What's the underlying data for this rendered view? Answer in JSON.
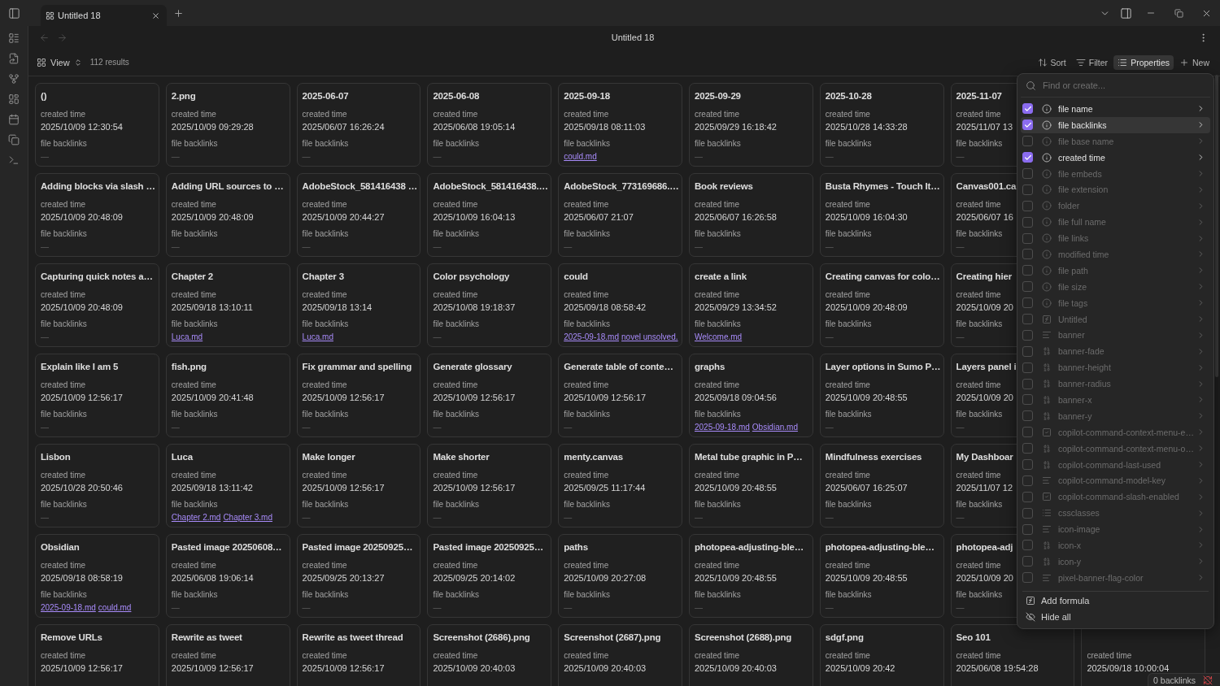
{
  "tabs": [
    {
      "title": "Untitled 18",
      "selected": true
    }
  ],
  "navigation": {
    "back": {
      "disabled": true
    },
    "forward": {
      "disabled": true
    }
  },
  "header": {
    "title": "Untitled 18"
  },
  "toolbar": {
    "view": "View",
    "results": "112 results",
    "actions": [
      {
        "kind": "sort",
        "label": "Sort",
        "selected": false
      },
      {
        "kind": "filter",
        "label": "Filter",
        "selected": false
      },
      {
        "kind": "properties",
        "label": "Properties",
        "selected": true
      },
      {
        "kind": "new",
        "label": "New",
        "selected": false
      }
    ]
  },
  "rows": [
    {
      "cards": [
        {
          "title": "()",
          "fields": [
            {
              "kind": "date",
              "label": "created time",
              "value": "2025/10/09 12:30:54"
            },
            {
              "kind": "empty",
              "label": "file backlinks",
              "value": "—"
            }
          ]
        },
        {
          "title": "2.png",
          "fields": [
            {
              "kind": "date",
              "label": "created time",
              "value": "2025/10/09 09:29:28"
            },
            {
              "kind": "empty",
              "label": "file backlinks",
              "value": "—"
            }
          ]
        },
        {
          "title": "2025-06-07",
          "fields": [
            {
              "kind": "date",
              "label": "created time",
              "value": "2025/06/07 16:26:24"
            },
            {
              "kind": "empty",
              "label": "file backlinks",
              "value": "—"
            }
          ]
        },
        {
          "title": "2025-06-08",
          "fields": [
            {
              "kind": "date",
              "label": "created time",
              "value": "2025/06/08 19:05:14"
            },
            {
              "kind": "empty",
              "label": "file backlinks",
              "value": "—"
            }
          ]
        },
        {
          "title": "2025-09-18",
          "fields": [
            {
              "kind": "date",
              "label": "created time",
              "value": "2025/09/18 08:11:03"
            },
            {
              "kind": "links",
              "label": "file backlinks",
              "links": [
                "could.md"
              ]
            }
          ]
        },
        {
          "title": "2025-09-29",
          "fields": [
            {
              "kind": "date",
              "label": "created time",
              "value": "2025/09/29 16:18:42"
            },
            {
              "kind": "empty",
              "label": "file backlinks",
              "value": "—"
            }
          ]
        },
        {
          "title": "2025-10-28",
          "fields": [
            {
              "kind": "date",
              "label": "created time",
              "value": "2025/10/28 14:33:28"
            },
            {
              "kind": "empty",
              "label": "file backlinks",
              "value": "—"
            }
          ]
        },
        {
          "title": "2025-11-07",
          "fields": [
            {
              "kind": "date",
              "label": "created time",
              "value": "2025/11/07 13"
            },
            {
              "kind": "empty",
              "label": "file backlinks",
              "value": "—"
            }
          ]
        }
      ]
    },
    {
      "cards": [
        {
          "title": "Adding blocks via slash …",
          "fields": [
            {
              "kind": "date",
              "label": "created time",
              "value": "2025/10/09 20:48:09"
            },
            {
              "kind": "empty",
              "label": "file backlinks",
              "value": "—"
            }
          ]
        },
        {
          "title": "Adding URL sources to …",
          "fields": [
            {
              "kind": "date",
              "label": "created time",
              "value": "2025/10/09 20:48:09"
            },
            {
              "kind": "empty",
              "label": "file backlinks",
              "value": "—"
            }
          ]
        },
        {
          "title": "AdobeStock_581416438 …",
          "fields": [
            {
              "kind": "date",
              "label": "created time",
              "value": "2025/10/09 20:44:27"
            },
            {
              "kind": "empty",
              "label": "file backlinks",
              "value": "—"
            }
          ]
        },
        {
          "title": "AdobeStock_581416438.…",
          "fields": [
            {
              "kind": "date",
              "label": "created time",
              "value": "2025/10/09 16:04:13"
            },
            {
              "kind": "empty",
              "label": "file backlinks",
              "value": "—"
            }
          ]
        },
        {
          "title": "AdobeStock_773169686.…",
          "fields": [
            {
              "kind": "date",
              "label": "created time",
              "value": "2025/06/07 21:07"
            },
            {
              "kind": "empty",
              "label": "file backlinks",
              "value": "—"
            }
          ]
        },
        {
          "title": "Book reviews",
          "fields": [
            {
              "kind": "date",
              "label": "created time",
              "value": "2025/06/07 16:26:58"
            },
            {
              "kind": "empty",
              "label": "file backlinks",
              "value": "—"
            }
          ]
        },
        {
          "title": "Busta Rhymes - Touch It…",
          "fields": [
            {
              "kind": "date",
              "label": "created time",
              "value": "2025/10/09 16:04:30"
            },
            {
              "kind": "empty",
              "label": "file backlinks",
              "value": "—"
            }
          ]
        },
        {
          "title": "Canvas001.ca",
          "fields": [
            {
              "kind": "date",
              "label": "created time",
              "value": "2025/06/07 16"
            },
            {
              "kind": "empty",
              "label": "file backlinks",
              "value": "—"
            }
          ]
        }
      ]
    },
    {
      "cards": [
        {
          "title": "Capturing quick notes a…",
          "fields": [
            {
              "kind": "date",
              "label": "created time",
              "value": "2025/10/09 20:48:09"
            },
            {
              "kind": "empty",
              "label": "file backlinks",
              "value": "—"
            }
          ]
        },
        {
          "title": "Chapter 2",
          "fields": [
            {
              "kind": "date",
              "label": "created time",
              "value": "2025/09/18 13:10:11"
            },
            {
              "kind": "links",
              "label": "file backlinks",
              "links": [
                "Luca.md"
              ]
            }
          ]
        },
        {
          "title": "Chapter 3",
          "fields": [
            {
              "kind": "date",
              "label": "created time",
              "value": "2025/09/18 13:14"
            },
            {
              "kind": "links",
              "label": "file backlinks",
              "links": [
                "Luca.md"
              ]
            }
          ]
        },
        {
          "title": "Color psychology",
          "fields": [
            {
              "kind": "date",
              "label": "created time",
              "value": "2025/10/08 19:18:37"
            },
            {
              "kind": "empty",
              "label": "file backlinks",
              "value": "—"
            }
          ]
        },
        {
          "title": "could",
          "fields": [
            {
              "kind": "date",
              "label": "created time",
              "value": "2025/09/18 08:58:42"
            },
            {
              "kind": "links",
              "label": "file backlinks",
              "links": [
                "2025-09-18.md",
                "novel unsolved."
              ]
            }
          ]
        },
        {
          "title": "create a link",
          "fields": [
            {
              "kind": "date",
              "label": "created time",
              "value": "2025/09/29 13:34:52"
            },
            {
              "kind": "links",
              "label": "file backlinks",
              "links": [
                "Welcome.md"
              ]
            }
          ]
        },
        {
          "title": "Creating canvas for colo…",
          "fields": [
            {
              "kind": "date",
              "label": "created time",
              "value": "2025/10/09 20:48:09"
            },
            {
              "kind": "empty",
              "label": "file backlinks",
              "value": "—"
            }
          ]
        },
        {
          "title": "Creating hier",
          "fields": [
            {
              "kind": "date",
              "label": "created time",
              "value": "2025/10/09 20"
            },
            {
              "kind": "empty",
              "label": "file backlinks",
              "value": "—"
            }
          ]
        }
      ]
    },
    {
      "cards": [
        {
          "title": "Explain like I am 5",
          "fields": [
            {
              "kind": "date",
              "label": "created time",
              "value": "2025/10/09 12:56:17"
            },
            {
              "kind": "empty",
              "label": "file backlinks",
              "value": "—"
            }
          ]
        },
        {
          "title": "fish.png",
          "fields": [
            {
              "kind": "date",
              "label": "created time",
              "value": "2025/10/09 20:41:48"
            },
            {
              "kind": "empty",
              "label": "file backlinks",
              "value": "—"
            }
          ]
        },
        {
          "title": "Fix grammar and spelling",
          "fields": [
            {
              "kind": "date",
              "label": "created time",
              "value": "2025/10/09 12:56:17"
            },
            {
              "kind": "empty",
              "label": "file backlinks",
              "value": "—"
            }
          ]
        },
        {
          "title": "Generate glossary",
          "fields": [
            {
              "kind": "date",
              "label": "created time",
              "value": "2025/10/09 12:56:17"
            },
            {
              "kind": "empty",
              "label": "file backlinks",
              "value": "—"
            }
          ]
        },
        {
          "title": "Generate table of conte…",
          "fields": [
            {
              "kind": "date",
              "label": "created time",
              "value": "2025/10/09 12:56:17"
            },
            {
              "kind": "empty",
              "label": "file backlinks",
              "value": "—"
            }
          ]
        },
        {
          "title": "graphs",
          "fields": [
            {
              "kind": "date",
              "label": "created time",
              "value": "2025/09/18 09:04:56"
            },
            {
              "kind": "links",
              "label": "file backlinks",
              "links": [
                "2025-09-18.md",
                "Obsidian.md"
              ]
            }
          ]
        },
        {
          "title": "Layer options in Sumo P…",
          "fields": [
            {
              "kind": "date",
              "label": "created time",
              "value": "2025/10/09 20:48:55"
            },
            {
              "kind": "empty",
              "label": "file backlinks",
              "value": "—"
            }
          ]
        },
        {
          "title": "Layers panel i",
          "fields": [
            {
              "kind": "date",
              "label": "created time",
              "value": "2025/10/09 20"
            },
            {
              "kind": "empty",
              "label": "file backlinks",
              "value": "—"
            }
          ]
        }
      ]
    },
    {
      "cards": [
        {
          "title": "Lisbon",
          "fields": [
            {
              "kind": "date",
              "label": "created time",
              "value": "2025/10/28 20:50:46"
            },
            {
              "kind": "empty",
              "label": "file backlinks",
              "value": "—"
            }
          ]
        },
        {
          "title": "Luca",
          "fields": [
            {
              "kind": "date",
              "label": "created time",
              "value": "2025/09/18 13:11:42"
            },
            {
              "kind": "links",
              "label": "file backlinks",
              "links": [
                "Chapter 2.md",
                "Chapter 3.md"
              ]
            }
          ]
        },
        {
          "title": "Make longer",
          "fields": [
            {
              "kind": "date",
              "label": "created time",
              "value": "2025/10/09 12:56:17"
            },
            {
              "kind": "empty",
              "label": "file backlinks",
              "value": "—"
            }
          ]
        },
        {
          "title": "Make shorter",
          "fields": [
            {
              "kind": "date",
              "label": "created time",
              "value": "2025/10/09 12:56:17"
            },
            {
              "kind": "empty",
              "label": "file backlinks",
              "value": "—"
            }
          ]
        },
        {
          "title": "menty.canvas",
          "fields": [
            {
              "kind": "date",
              "label": "created time",
              "value": "2025/09/25 11:17:44"
            },
            {
              "kind": "empty",
              "label": "file backlinks",
              "value": "—"
            }
          ]
        },
        {
          "title": "Metal tube graphic in P…",
          "fields": [
            {
              "kind": "date",
              "label": "created time",
              "value": "2025/10/09 20:48:55"
            },
            {
              "kind": "empty",
              "label": "file backlinks",
              "value": "—"
            }
          ]
        },
        {
          "title": "Mindfulness exercises",
          "fields": [
            {
              "kind": "date",
              "label": "created time",
              "value": "2025/06/07 16:25:07"
            },
            {
              "kind": "empty",
              "label": "file backlinks",
              "value": "—"
            }
          ]
        },
        {
          "title": "My Dashboar",
          "fields": [
            {
              "kind": "date",
              "label": "created time",
              "value": "2025/11/07 12"
            },
            {
              "kind": "empty",
              "label": "file backlinks",
              "value": "—"
            }
          ]
        }
      ]
    },
    {
      "cards": [
        {
          "title": "Obsidian",
          "fields": [
            {
              "kind": "date",
              "label": "created time",
              "value": "2025/09/18 08:58:19"
            },
            {
              "kind": "links",
              "label": "file backlinks",
              "links": [
                "2025-09-18.md",
                "could.md"
              ]
            }
          ]
        },
        {
          "title": "Pasted image 20250608…",
          "fields": [
            {
              "kind": "date",
              "label": "created time",
              "value": "2025/06/08 19:06:14"
            },
            {
              "kind": "empty",
              "label": "file backlinks",
              "value": "—"
            }
          ]
        },
        {
          "title": "Pasted image 20250925…",
          "fields": [
            {
              "kind": "date",
              "label": "created time",
              "value": "2025/09/25 20:13:27"
            },
            {
              "kind": "empty",
              "label": "file backlinks",
              "value": "—"
            }
          ]
        },
        {
          "title": "Pasted image 20250925…",
          "fields": [
            {
              "kind": "date",
              "label": "created time",
              "value": "2025/09/25 20:14:02"
            },
            {
              "kind": "empty",
              "label": "file backlinks",
              "value": "—"
            }
          ]
        },
        {
          "title": "paths",
          "fields": [
            {
              "kind": "date",
              "label": "created time",
              "value": "2025/10/09 20:27:08"
            },
            {
              "kind": "empty",
              "label": "file backlinks",
              "value": "—"
            }
          ]
        },
        {
          "title": "photopea-adjusting-ble…",
          "fields": [
            {
              "kind": "date",
              "label": "created time",
              "value": "2025/10/09 20:48:55"
            },
            {
              "kind": "empty",
              "label": "file backlinks",
              "value": "—"
            }
          ]
        },
        {
          "title": "photopea-adjusting-ble…",
          "fields": [
            {
              "kind": "date",
              "label": "created time",
              "value": "2025/10/09 20:48:55"
            },
            {
              "kind": "empty",
              "label": "file backlinks",
              "value": "—"
            }
          ]
        },
        {
          "title": "photopea-adj",
          "fields": [
            {
              "kind": "date",
              "label": "created time",
              "value": "2025/10/09 20"
            },
            {
              "kind": "empty",
              "label": "file backlinks",
              "value": "—"
            }
          ]
        }
      ]
    },
    {
      "cards": [
        {
          "title": "Remove URLs",
          "fields": [
            {
              "kind": "date",
              "label": "created time",
              "value": "2025/10/09 12:56:17"
            }
          ]
        },
        {
          "title": "Rewrite as tweet",
          "fields": [
            {
              "kind": "date",
              "label": "created time",
              "value": "2025/10/09 12:56:17"
            }
          ]
        },
        {
          "title": "Rewrite as tweet thread",
          "fields": [
            {
              "kind": "date",
              "label": "created time",
              "value": "2025/10/09 12:56:17"
            }
          ]
        },
        {
          "title": "Screenshot (2686).png",
          "fields": [
            {
              "kind": "date",
              "label": "created time",
              "value": "2025/10/09 20:40:03"
            }
          ]
        },
        {
          "title": "Screenshot (2687).png",
          "fields": [
            {
              "kind": "date",
              "label": "created time",
              "value": "2025/10/09 20:40:03"
            }
          ]
        },
        {
          "title": "Screenshot (2688).png",
          "fields": [
            {
              "kind": "date",
              "label": "created time",
              "value": "2025/10/09 20:40:03"
            }
          ]
        },
        {
          "title": "sdgf.png",
          "fields": [
            {
              "kind": "date",
              "label": "created time",
              "value": "2025/10/09 20:42"
            }
          ]
        },
        {
          "title": "Seo 101",
          "fields": [
            {
              "kind": "date",
              "label": "created time",
              "value": "2025/06/08 19:54:28"
            }
          ]
        },
        {
          "fields": [
            {
              "kind": "date",
              "label": "created time",
              "value": "2025/09/18 10:00:04"
            }
          ]
        }
      ]
    }
  ],
  "properties_menu": {
    "placeholder": "Find or create...",
    "items": [
      {
        "kind": "info",
        "label": "file name",
        "checked": true,
        "selected": false
      },
      {
        "kind": "info",
        "label": "file backlinks",
        "checked": true,
        "selected": true
      },
      {
        "kind": "info",
        "label": "file base name",
        "checked": false,
        "selected": false
      },
      {
        "kind": "info",
        "label": "created time",
        "checked": true,
        "selected": false
      },
      {
        "kind": "info",
        "label": "file embeds",
        "checked": false,
        "selected": false
      },
      {
        "kind": "info",
        "label": "file extension",
        "checked": false,
        "selected": false
      },
      {
        "kind": "info",
        "label": "folder",
        "checked": false,
        "selected": false
      },
      {
        "kind": "info",
        "label": "file full name",
        "checked": false,
        "selected": false
      },
      {
        "kind": "info",
        "label": "file links",
        "checked": false,
        "selected": false
      },
      {
        "kind": "info",
        "label": "modified time",
        "checked": false,
        "selected": false
      },
      {
        "kind": "info",
        "label": "file path",
        "checked": false,
        "selected": false
      },
      {
        "kind": "info",
        "label": "file size",
        "checked": false,
        "selected": false
      },
      {
        "kind": "info",
        "label": "file tags",
        "checked": false,
        "selected": false
      },
      {
        "kind": "formula",
        "label": "Untitled",
        "checked": false,
        "selected": false
      },
      {
        "kind": "text",
        "label": "banner",
        "checked": false,
        "selected": false
      },
      {
        "kind": "number",
        "label": "banner-fade",
        "checked": false,
        "selected": false
      },
      {
        "kind": "number",
        "label": "banner-height",
        "checked": false,
        "selected": false
      },
      {
        "kind": "number",
        "label": "banner-radius",
        "checked": false,
        "selected": false
      },
      {
        "kind": "number",
        "label": "banner-x",
        "checked": false,
        "selected": false
      },
      {
        "kind": "number",
        "label": "banner-y",
        "checked": false,
        "selected": false
      },
      {
        "kind": "checkbox",
        "label": "copilot-command-context-menu-e…",
        "checked": false,
        "selected": false
      },
      {
        "kind": "number",
        "label": "copilot-command-context-menu-o…",
        "checked": false,
        "selected": false
      },
      {
        "kind": "number",
        "label": "copilot-command-last-used",
        "checked": false,
        "selected": false
      },
      {
        "kind": "text",
        "label": "copilot-command-model-key",
        "checked": false,
        "selected": false
      },
      {
        "kind": "checkbox",
        "label": "copilot-command-slash-enabled",
        "checked": false,
        "selected": false
      },
      {
        "kind": "list",
        "label": "cssclasses",
        "checked": false,
        "selected": false
      },
      {
        "kind": "text",
        "label": "icon-image",
        "checked": false,
        "selected": false
      },
      {
        "kind": "number",
        "label": "icon-x",
        "checked": false,
        "selected": false
      },
      {
        "kind": "number",
        "label": "icon-y",
        "checked": false,
        "selected": false
      },
      {
        "kind": "text",
        "label": "pixel-banner-flag-color",
        "checked": false,
        "selected": false
      }
    ],
    "actions": [
      {
        "kind": "formula",
        "label": "Add formula"
      },
      {
        "kind": "hide",
        "label": "Hide all"
      }
    ]
  },
  "status_bar": {
    "text": "0 backlinks"
  }
}
